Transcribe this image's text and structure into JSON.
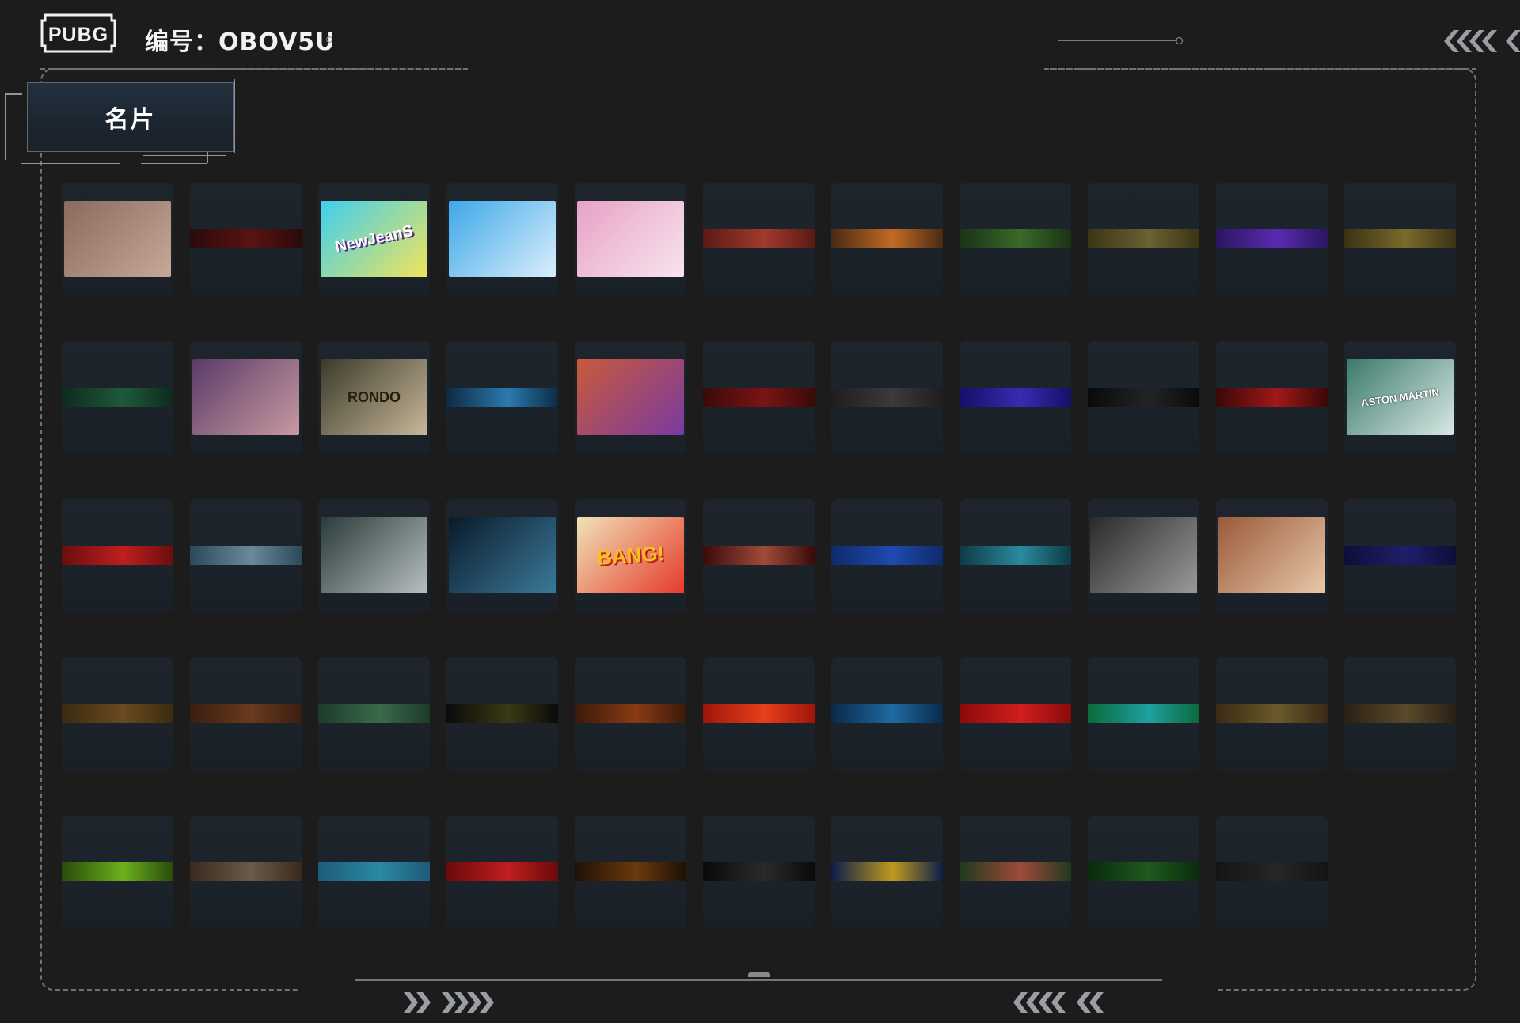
{
  "header": {
    "logo_text": "PUBG",
    "code_label": "编号：OBOV5U"
  },
  "tab": {
    "label": "名片"
  },
  "colors": {
    "background": "#1c1c1d",
    "card": "#1e252d",
    "frame": "#6e7176"
  },
  "icons": {
    "logo": "pubg-logo-icon",
    "top_right": "chevrons-left-icon",
    "bottom_left": "chevrons-right-icon",
    "bottom_right": "chevrons-left-icon"
  },
  "grid": {
    "rows": [
      [
        {
          "kind": "image",
          "name": "sniper-silhouette",
          "colors": [
            "#8a6a5c",
            "#c8a897"
          ]
        },
        {
          "kind": "stripe",
          "colors": [
            "#2a0b0b",
            "#5a1212"
          ]
        },
        {
          "kind": "image",
          "name": "newjeans",
          "label": "NewJeanS",
          "colors": [
            "#3ecff0",
            "#f1e45a"
          ]
        },
        {
          "kind": "image",
          "name": "seal-surf",
          "colors": [
            "#3ea8e8",
            "#d9eefc"
          ]
        },
        {
          "kind": "image",
          "name": "pink-girl",
          "colors": [
            "#e7a2c6",
            "#f7e4ee"
          ]
        },
        {
          "kind": "stripe",
          "colors": [
            "#5a1a14",
            "#a23a2c"
          ]
        },
        {
          "kind": "stripe",
          "colors": [
            "#4a2a12",
            "#c26a24"
          ]
        },
        {
          "kind": "stripe",
          "colors": [
            "#1a3216",
            "#3a6a2a"
          ]
        },
        {
          "kind": "stripe",
          "colors": [
            "#3a3416",
            "#6a6232"
          ]
        },
        {
          "kind": "stripe",
          "colors": [
            "#2a1660",
            "#5a2ab0"
          ]
        },
        {
          "kind": "stripe",
          "colors": [
            "#3a3214",
            "#7a6a2a"
          ]
        }
      ],
      [
        {
          "kind": "stripe",
          "colors": [
            "#0e2a1e",
            "#1e5a3a"
          ]
        },
        {
          "kind": "image",
          "name": "purple-hair-girl",
          "colors": [
            "#5a3a6a",
            "#c89aa0"
          ]
        },
        {
          "kind": "image",
          "name": "rondo-cards",
          "label": "RONDO",
          "colors": [
            "#3a3a2a",
            "#c8b89a"
          ]
        },
        {
          "kind": "stripe",
          "colors": [
            "#0e2a44",
            "#2a7ab0"
          ]
        },
        {
          "kind": "image",
          "name": "halloween-pumpkin",
          "colors": [
            "#c85a3a",
            "#7a3aa0"
          ]
        },
        {
          "kind": "stripe",
          "colors": [
            "#3a0a0a",
            "#7a1414"
          ]
        },
        {
          "kind": "stripe",
          "colors": [
            "#1e1e1e",
            "#3a3a3a"
          ]
        },
        {
          "kind": "stripe",
          "colors": [
            "#14106a",
            "#3a2ab0"
          ]
        },
        {
          "kind": "stripe",
          "colors": [
            "#0a0a0a",
            "#222426"
          ]
        },
        {
          "kind": "stripe",
          "colors": [
            "#3a0808",
            "#a01818"
          ]
        },
        {
          "kind": "image",
          "name": "aston-martin",
          "label": "ASTON MARTIN",
          "colors": [
            "#3a7a6a",
            "#d8e8e4"
          ]
        }
      ],
      [
        {
          "kind": "stripe",
          "colors": [
            "#6a0e0e",
            "#c01e1e"
          ]
        },
        {
          "kind": "stripe",
          "colors": [
            "#2a4a5a",
            "#6a8a9a"
          ]
        },
        {
          "kind": "image",
          "name": "car-white-smoke",
          "colors": [
            "#2a3a3a",
            "#b8c0c0"
          ]
        },
        {
          "kind": "image",
          "name": "car-blue",
          "colors": [
            "#0a1a2a",
            "#3a7a9a"
          ]
        },
        {
          "kind": "image",
          "name": "bang-comic",
          "label": "BANG!",
          "colors": [
            "#f0e2b8",
            "#e63a2a"
          ]
        },
        {
          "kind": "stripe",
          "colors": [
            "#3a0a0a",
            "#a04a3a"
          ]
        },
        {
          "kind": "stripe",
          "colors": [
            "#0e2a6a",
            "#1e4ab0"
          ]
        },
        {
          "kind": "stripe",
          "colors": [
            "#0e3a44",
            "#2a8aa0"
          ]
        },
        {
          "kind": "image",
          "name": "helmet-soldier",
          "colors": [
            "#2a2a2a",
            "#9a9a9a"
          ]
        },
        {
          "kind": "image",
          "name": "goggles-woman",
          "colors": [
            "#9a5a3a",
            "#e8c8a8"
          ]
        },
        {
          "kind": "stripe",
          "colors": [
            "#0e0e3a",
            "#1e1e6a"
          ]
        }
      ],
      [
        {
          "kind": "stripe",
          "colors": [
            "#3a2a10",
            "#6a4a1e"
          ]
        },
        {
          "kind": "stripe",
          "colors": [
            "#3a1e10",
            "#6a3a1e"
          ]
        },
        {
          "kind": "stripe",
          "colors": [
            "#1e3a2a",
            "#3a6a4a"
          ]
        },
        {
          "kind": "stripe",
          "colors": [
            "#0a0a0a",
            "#3a3a14"
          ]
        },
        {
          "kind": "stripe",
          "colors": [
            "#3a1a0a",
            "#8a3a14"
          ]
        },
        {
          "kind": "stripe",
          "colors": [
            "#a0140a",
            "#e6401a"
          ]
        },
        {
          "kind": "stripe",
          "colors": [
            "#0a2a4a",
            "#1e6aa0"
          ]
        },
        {
          "kind": "stripe",
          "colors": [
            "#8a0a0a",
            "#d01e1e"
          ]
        },
        {
          "kind": "stripe",
          "colors": [
            "#0a6a3a",
            "#1ea0a0"
          ]
        },
        {
          "kind": "stripe",
          "colors": [
            "#3a2a14",
            "#6a5a2a"
          ]
        },
        {
          "kind": "stripe",
          "colors": [
            "#2a2014",
            "#5a4a2a"
          ]
        }
      ],
      [
        {
          "kind": "stripe",
          "colors": [
            "#2a4a0a",
            "#6ab01e"
          ]
        },
        {
          "kind": "stripe",
          "colors": [
            "#3a2a1e",
            "#6a5a4a"
          ]
        },
        {
          "kind": "stripe",
          "colors": [
            "#1e5a7a",
            "#2a8aa0"
          ]
        },
        {
          "kind": "stripe",
          "colors": [
            "#6a0a0a",
            "#c01e1e"
          ]
        },
        {
          "kind": "stripe",
          "colors": [
            "#1e1006",
            "#6a3a0e"
          ]
        },
        {
          "kind": "stripe",
          "colors": [
            "#0a0a0a",
            "#2a2a2a"
          ]
        },
        {
          "kind": "stripe",
          "colors": [
            "#0a1e4a",
            "#c09a1e"
          ]
        },
        {
          "kind": "stripe",
          "colors": [
            "#1e3a1e",
            "#a04a3a"
          ]
        },
        {
          "kind": "stripe",
          "colors": [
            "#0a2a0e",
            "#1e5a1e"
          ]
        },
        {
          "kind": "stripe",
          "colors": [
            "#141414",
            "#262626"
          ]
        }
      ]
    ]
  }
}
